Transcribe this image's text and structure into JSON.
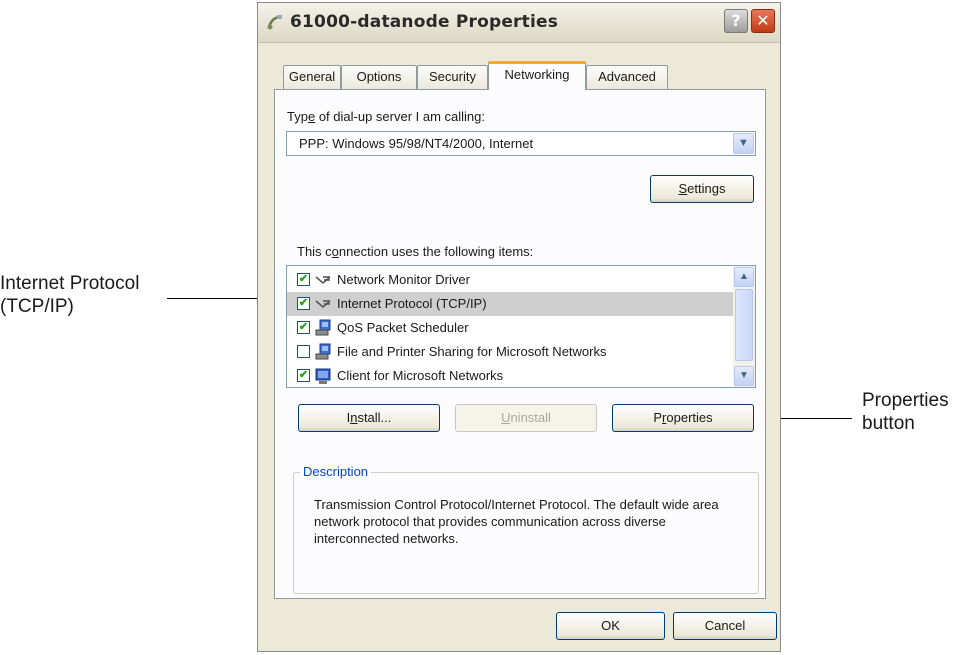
{
  "annotations": {
    "left_callout_line1": "Internet Protocol",
    "left_callout_line2": "(TCP/IP)",
    "right_callout_line1": "Properties",
    "right_callout_line2": "button"
  },
  "window": {
    "title": "61000-datanode Properties",
    "help_label": "?",
    "close_label": "✕"
  },
  "tabs": [
    "General",
    "Options",
    "Security",
    "Networking",
    "Advanced"
  ],
  "active_tab": "Networking",
  "networking": {
    "dialup_label_pre": "Typ",
    "dialup_label_accel": "e",
    "dialup_label_post": " of dial-up server I am calling:",
    "dialup_value": "PPP: Windows 95/98/NT4/2000, Internet",
    "settings_accel": "S",
    "settings_rest": "ettings",
    "items_label_pre": "This c",
    "items_label_accel": "o",
    "items_label_post": "nnection uses the following items:",
    "items": [
      {
        "label": "Network Monitor Driver",
        "checked": true,
        "icon": "network-protocol-icon"
      },
      {
        "label": "Internet Protocol (TCP/IP)",
        "checked": true,
        "icon": "network-protocol-icon",
        "selected": true
      },
      {
        "label": "QoS Packet Scheduler",
        "checked": true,
        "icon": "network-service-icon"
      },
      {
        "label": "File and Printer Sharing for Microsoft Networks",
        "checked": false,
        "icon": "network-service-icon"
      },
      {
        "label": "Client for Microsoft Networks",
        "checked": true,
        "icon": "network-client-icon"
      }
    ],
    "install_pre": "I",
    "install_accel": "n",
    "install_post": "stall...",
    "uninstall_accel": "U",
    "uninstall_rest": "ninstall",
    "properties_pre": "P",
    "properties_accel": "r",
    "properties_post": "operties",
    "description_title": "Description",
    "description_text": "Transmission Control Protocol/Internet Protocol. The default wide area network protocol that provides communication across diverse interconnected networks."
  },
  "footer": {
    "ok_label": "OK",
    "cancel_label": "Cancel"
  },
  "colors": {
    "dialog_bg": "#ece9d8",
    "tab_accent": "#f6a833",
    "close_button": "#c03a14",
    "groupbox_title": "#0046d5",
    "selected_row": "#cfcfcf"
  }
}
